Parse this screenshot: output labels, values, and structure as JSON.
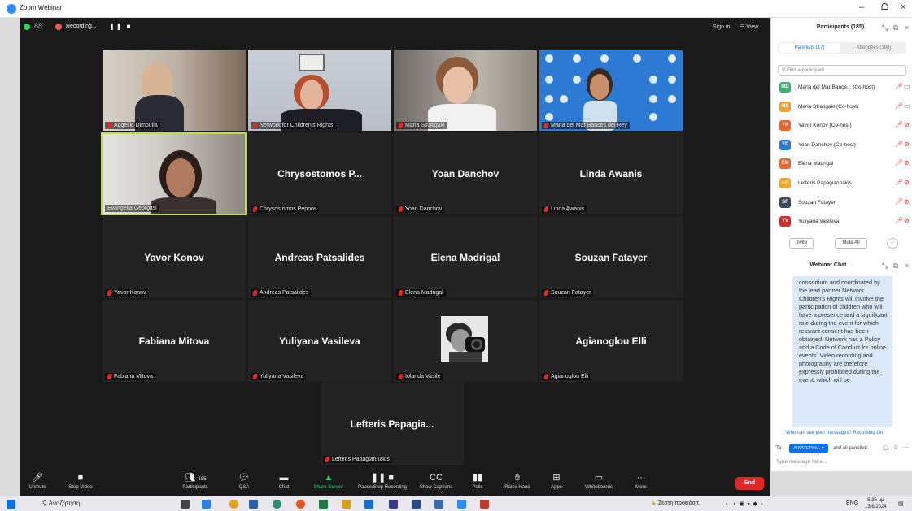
{
  "window": {
    "title": "Zoom Webinar",
    "minimize": "–",
    "restore": "ᗝ",
    "close": "×"
  },
  "topbar": {
    "grid_icon": "88",
    "recording_label": "Recording...",
    "recording_controls": "❚❚ ■",
    "signin": "Sign in",
    "view": "☰ View"
  },
  "tiles": [
    {
      "label": "Aggeliki Dimoulia",
      "video": true
    },
    {
      "label": "Network for Children's Rights",
      "video": true
    },
    {
      "label": "Maria Stratigaki",
      "video": true
    },
    {
      "label": "Maria del Mar Bances del Rey",
      "video": true
    },
    {
      "label": "Evangelia Georgitsi",
      "video": true
    },
    {
      "display_name": "Chrysostomos P...",
      "label": "Chrysostomos Peppos"
    },
    {
      "display_name": "Yoan Danchov",
      "label": "Yoan Danchov"
    },
    {
      "display_name": "Linda Awanis",
      "label": "Linda Awanis"
    },
    {
      "display_name": "Yavor Konov",
      "label": "Yavor Konov"
    },
    {
      "display_name": "Andreas Patsalides",
      "label": "Andreas Patsalides"
    },
    {
      "display_name": "Elena Madrigal",
      "label": "Elena Madrigal"
    },
    {
      "display_name": "Souzan Fatayer",
      "label": "Souzan Fatayer"
    },
    {
      "display_name": "Fabiana Mitova",
      "label": "Fabiana Mitova"
    },
    {
      "display_name": "Yuliyana Vasileva",
      "label": "Yuliyana Vasileva"
    },
    {
      "label": "Iolanda Vasile",
      "video": false
    },
    {
      "display_name": "Agianoglou Elli",
      "label": "Agianoglou Elli"
    },
    {
      "display_name": "Lefteris Papagia...",
      "label": "Lefteris Papagiannakis"
    }
  ],
  "toolbar": {
    "unmute": "Unmute",
    "stop_video": "Stop Video",
    "participants": "Participants",
    "participants_count": "185",
    "qa": "Q&A",
    "chat": "Chat",
    "share_screen": "Share Screen",
    "pause_recording": "Pause/Stop Recording",
    "show_captions": "Show Captions",
    "polls": "Polls",
    "raise_hand": "Raise Hand",
    "apps": "Apps",
    "whiteboards": "Whiteboards",
    "more": "More",
    "end": "End"
  },
  "participants_panel": {
    "title": "Participants (185)",
    "tab_panelists": "Panelists (17)",
    "tab_attendees": "Attendees (168)",
    "search_placeholder": "Find a participant",
    "list": [
      {
        "initials": "MD",
        "name": "Maria del Mar Bance... (Co-host)",
        "color": "#3cb371",
        "cam": "on"
      },
      {
        "initials": "MS",
        "name": "Maria Stratigaki (Co-host)",
        "color": "#f0a030",
        "cam": "on"
      },
      {
        "initials": "YK",
        "name": "Yavor Konov (Co-host)",
        "color": "#e8662a",
        "cam": "off"
      },
      {
        "initials": "YD",
        "name": "Yoan Danchov (Co-host)",
        "color": "#2e7bd6",
        "cam": "off"
      },
      {
        "initials": "EM",
        "name": "Elena Madrigal",
        "color": "#e8662a",
        "cam": "off"
      },
      {
        "initials": "LP",
        "name": "Lefteris Papagiannakis",
        "color": "#f5a623",
        "cam": "off"
      },
      {
        "initials": "SF",
        "name": "Souzan Fatayer",
        "color": "#3a4a5c",
        "cam": "off"
      },
      {
        "initials": "YV",
        "name": "Yuliyana Vasileva",
        "color": "#d62a2a",
        "cam": "off"
      }
    ],
    "invite": "Invite",
    "mute_all": "Mute All",
    "more": "···"
  },
  "chat": {
    "title": "Webinar Chat",
    "message": "consortium and coordinated by the lead partner Network Children's Rights will involve the participation of children who will have a presence and a significant role during the event for which relevant consent has been obtained. Network has a Policy and a Code of Conduct for online events. Video recording and photography are therefore expressly prohibited during the event, which will be",
    "who_can_see": "Who can see your messages? Recording On",
    "to_label": "To:",
    "to_recipient": "AIKATEPIN...",
    "to_rest": "and all panelists",
    "type_placeholder": "Type message here..."
  },
  "taskbar": {
    "search": "Αναζήτηση",
    "weather": "Ζέστη προειδοπ.",
    "lang": "ENG",
    "time": "5:35 μμ",
    "date": "13/6/2024"
  }
}
